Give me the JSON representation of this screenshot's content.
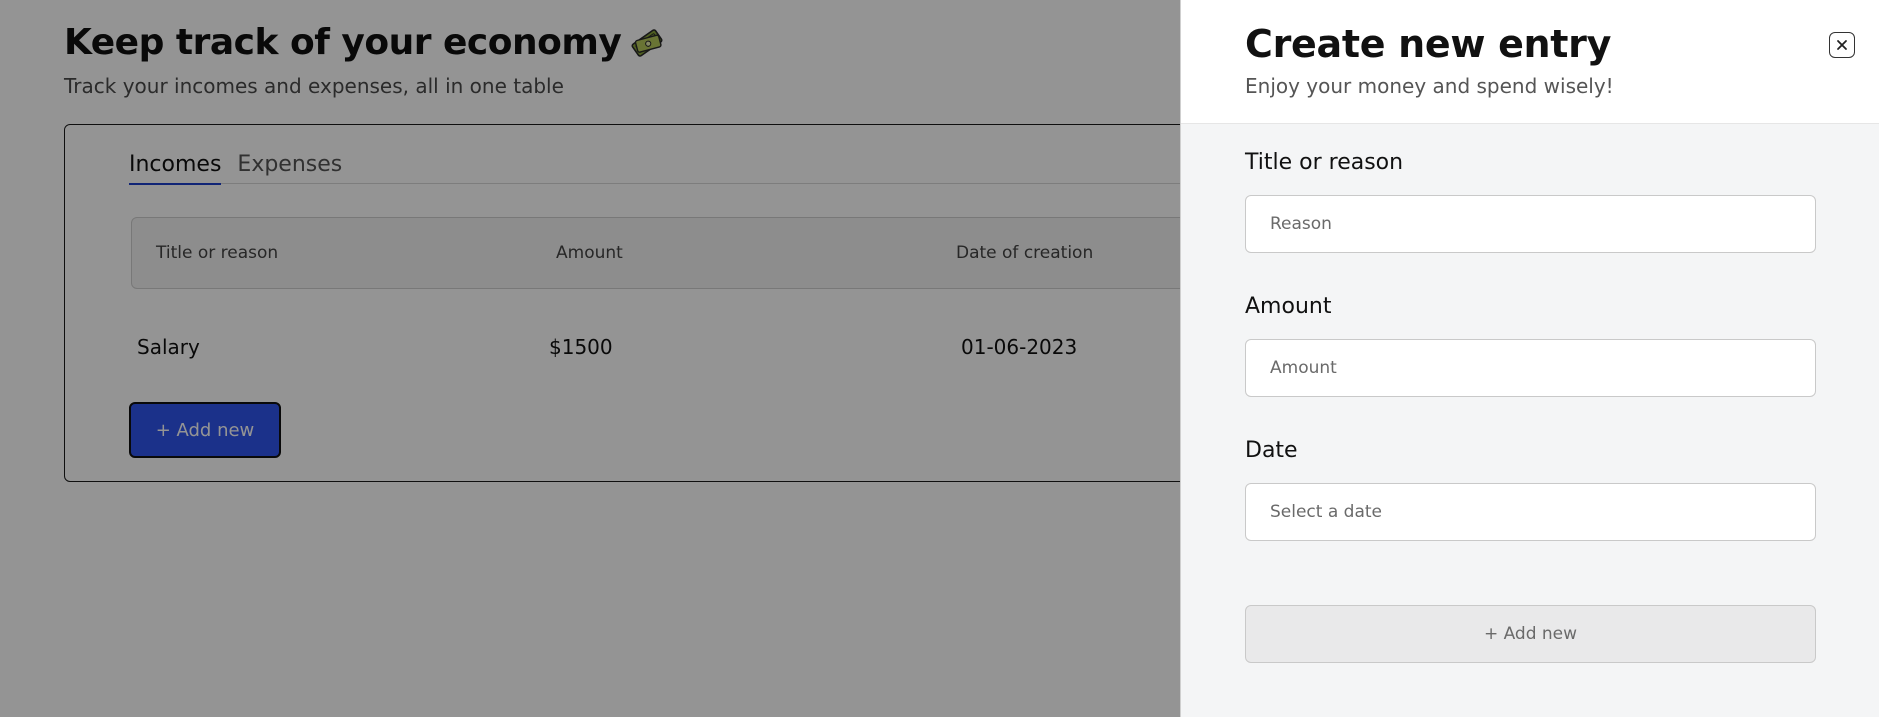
{
  "page": {
    "title": "Keep track of your economy",
    "subtitle": "Track your incomes and expenses, all in one table",
    "title_icon": "money-icon"
  },
  "tabs": [
    {
      "label": "Incomes",
      "active": true
    },
    {
      "label": "Expenses",
      "active": false
    }
  ],
  "table": {
    "columns": [
      "Title or reason",
      "Amount",
      "Date of creation"
    ],
    "rows": [
      {
        "title": "Salary",
        "amount": "$1500",
        "date": "01-06-2023"
      }
    ]
  },
  "main": {
    "add_button_label": "+ Add new"
  },
  "drawer": {
    "title": "Create new entry",
    "subtitle": "Enjoy your money and spend wisely!",
    "close_icon": "close-icon",
    "fields": [
      {
        "label": "Title or reason",
        "placeholder": "Reason",
        "value": ""
      },
      {
        "label": "Amount",
        "placeholder": "Amount",
        "value": ""
      },
      {
        "label": "Date",
        "placeholder": "Select a date",
        "value": ""
      }
    ],
    "submit_label": "+ Add new"
  },
  "colors": {
    "accent": "#2f55ee",
    "tab_underline": "#1d3fcc",
    "overlay": "rgba(0,0,0,0.42)",
    "drawer_bg": "#f4f5f6",
    "disabled_button": "#e9e9ea"
  }
}
